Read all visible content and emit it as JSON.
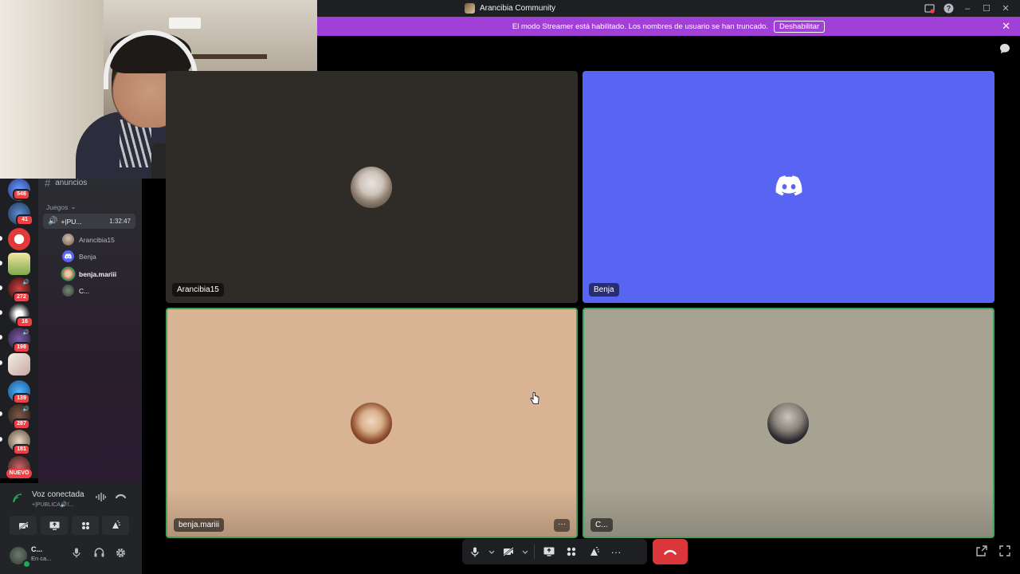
{
  "window": {
    "title": "Arancibia Community",
    "help_icon": "?",
    "minimize": "–",
    "maximize": "☐",
    "close": "✕"
  },
  "streamer_banner": {
    "message": "El modo Streamer está habilitado. Los nombres de usuario se han truncado.",
    "button_label": "Deshabilitar",
    "close": "✕"
  },
  "servers": [
    {
      "badge": "546"
    },
    {
      "badge": "41"
    },
    {
      "badge": ""
    },
    {
      "badge": ""
    },
    {
      "badge": "272"
    },
    {
      "badge": "16"
    },
    {
      "badge": "198"
    },
    {
      "badge": ""
    },
    {
      "badge": "139"
    },
    {
      "badge": "287"
    },
    {
      "badge": "181"
    }
  ],
  "new_label": "NUEVO",
  "channels": {
    "text_channel": "anuncios",
    "category": "Juegos",
    "category_chevron": "⌄",
    "voice_channel": {
      "name": "+|PU...",
      "time": "1:32:47"
    },
    "voice_users": [
      {
        "name": "Arancibia15"
      },
      {
        "name": "Benja"
      },
      {
        "name": "benja.mariii"
      },
      {
        "name": "C..."
      }
    ]
  },
  "voice_panel": {
    "status": "Voz conectada",
    "channel": "+|PUBLICA🔊/..."
  },
  "user_panel": {
    "name": "C...",
    "status": "En ca..."
  },
  "tiles": [
    {
      "name": "Arancibia15",
      "bg": "#2f2b27"
    },
    {
      "name": "Benja",
      "bg": "#5865f2"
    },
    {
      "name": "benja.mariii",
      "bg": "#d9b494"
    },
    {
      "name": "C...",
      "bg": "#a6a393"
    }
  ],
  "tile_menu": "···",
  "controls": {
    "more": "···"
  },
  "colors": {
    "accent": "#5865f2",
    "streamer": "#a140d6",
    "hangup": "#da373c",
    "speaking": "#23a55a"
  }
}
